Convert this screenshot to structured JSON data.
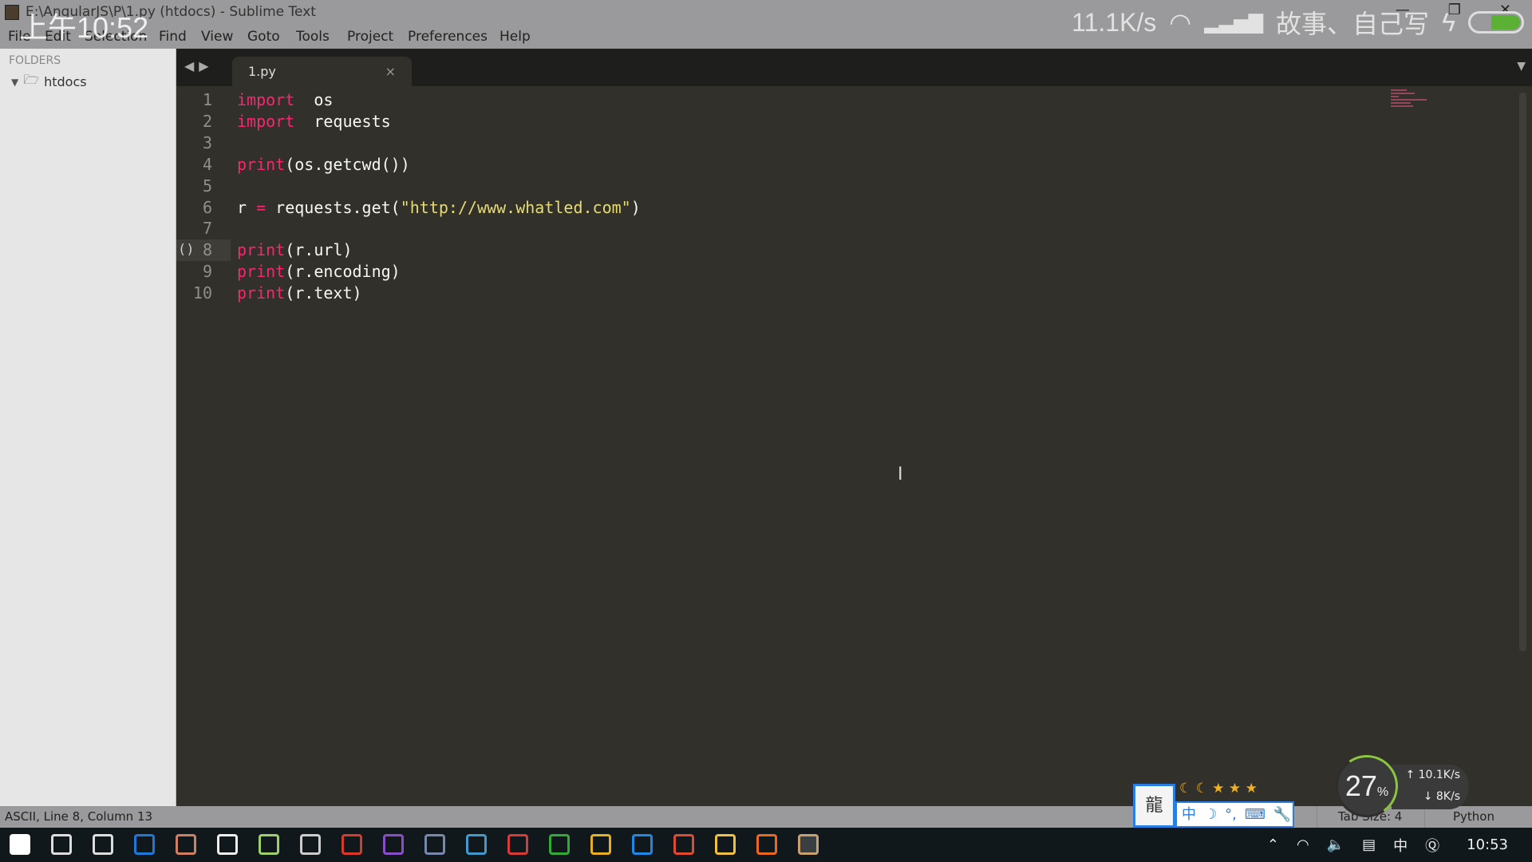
{
  "window": {
    "title": "E:\\AngularJS\\P\\1.py (htdocs) - Sublime Text"
  },
  "overlay": {
    "time": "上午10:52",
    "net_speed": "11.1K/s",
    "carrier": "故事、自己写"
  },
  "menu": [
    "File",
    "Edit",
    "Selection",
    "Find",
    "View",
    "Goto",
    "Tools",
    "Project",
    "Preferences",
    "Help"
  ],
  "sidebar": {
    "header": "FOLDERS",
    "folder": "htdocs"
  },
  "tab": {
    "label": "1.py",
    "close": "×"
  },
  "editor": {
    "lines": [
      {
        "n": "1",
        "tokens": [
          [
            "kw",
            "import"
          ],
          [
            "",
            "  os"
          ]
        ]
      },
      {
        "n": "2",
        "tokens": [
          [
            "kw",
            "import"
          ],
          [
            "",
            "  requests"
          ]
        ]
      },
      {
        "n": "3",
        "tokens": []
      },
      {
        "n": "4",
        "tokens": [
          [
            "kw",
            "print"
          ],
          [
            "",
            "(os.getcwd())"
          ]
        ]
      },
      {
        "n": "5",
        "tokens": []
      },
      {
        "n": "6",
        "tokens": [
          [
            "",
            "r "
          ],
          [
            "op",
            "="
          ],
          [
            "",
            " requests.get("
          ],
          [
            "st",
            "\"http://www.whatled.com\""
          ],
          [
            "",
            ")"
          ]
        ]
      },
      {
        "n": "7",
        "tokens": []
      },
      {
        "n": "8",
        "tokens": [
          [
            "kw",
            "print"
          ],
          [
            "",
            "(r.url)"
          ]
        ]
      },
      {
        "n": "9",
        "tokens": [
          [
            "kw",
            "print"
          ],
          [
            "",
            "(r.encoding)"
          ]
        ]
      },
      {
        "n": "10",
        "tokens": [
          [
            "kw",
            "print"
          ],
          [
            "",
            "(r.text)"
          ]
        ]
      }
    ],
    "current_line": "8",
    "fold_marker": "()"
  },
  "statusbar": {
    "position": "ASCII, Line 8, Column 13",
    "tab_size": "Tab Size: 4",
    "syntax": "Python"
  },
  "ime": {
    "logo": "龍",
    "bar": [
      "中",
      "☽",
      "°,",
      "⌨",
      "🔧"
    ]
  },
  "netmon": {
    "cpu": "27",
    "unit": "%",
    "up": "↑ 10.1K/s",
    "down": "↓ 8K/s"
  },
  "tray": {
    "ime": "中",
    "clock": "10:53"
  },
  "taskbar": {
    "colors": [
      "#ffffff",
      "#dddddd",
      "#dddddd",
      "#1e78d7",
      "#d08060",
      "#eeeeee",
      "#9ecf6a",
      "#cccccc",
      "#d83a2a",
      "#8a4fc8",
      "#7788aa",
      "#4499cc",
      "#d83a3a",
      "#33aa33",
      "#e8b020",
      "#1e88e5",
      "#e04a30",
      "#f0c040",
      "#e86a20",
      "#c8a070"
    ]
  }
}
